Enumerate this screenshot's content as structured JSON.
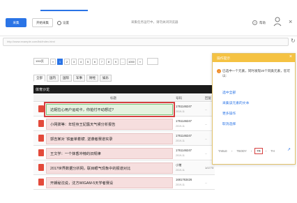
{
  "toolbar": {
    "primary_label": "采集",
    "secondary_label": "开始采集",
    "settings_label": "设置",
    "status_text": "采集任务运行中，请勿关闭浏览器",
    "help_label": "帮助"
  },
  "url": {
    "value": "http://www.example.com/list/index.html"
  },
  "pagination": {
    "page_size": "100/页",
    "prev": "«",
    "pages": [
      "1",
      "2",
      "3",
      "4",
      "5",
      "6",
      "7",
      "8",
      "9"
    ],
    "ellipsis": "...",
    "last": "1000",
    "next": "»"
  },
  "category_tabs": [
    "全部",
    "国内",
    "国际",
    "军事",
    "财经",
    "娱乐"
  ],
  "section_header": "体育沙龙",
  "table": {
    "headers": {
      "title": "标题",
      "number": "号码",
      "extra": "回复"
    },
    "rows": [
      {
        "title": "达妮拉心用户运动卡，你拍付不动想过?",
        "number": "1761146247",
        "date": "2019-11",
        "extra": "..."
      },
      {
        "title": "小网拨等：年轻身王妃露天气候分析报告",
        "number": "1761146247",
        "date": "2019-11",
        "extra": "..."
      },
      {
        "title": "郭吉某对 ‘铁面单着镜', 逆袭者赛道实录",
        "number": "1761146247",
        "date": "2019-11",
        "extra": "..."
      },
      {
        "title": "王文学：一个抹香冲榜的旧规律",
        "number": "1761146247",
        "date": "2019-11",
        "extra": "..."
      },
      {
        "title": "2017世界数据分析网，联目眼气现象中的报道对比",
        "number": "小猪",
        "date": "2019-11",
        "extra": "1/1773"
      },
      {
        "title": "开朗秘沈说，沈方WIGAM-5天学者赛设",
        "number": "1681763426",
        "date": "2019-11",
        "extra": "..."
      }
    ]
  },
  "panel": {
    "title": "操作提示",
    "close": "×",
    "message": "已选中一个元素，同时发现20个同类元素，您可以:",
    "links": [
      "选中全部",
      "采集该元素的文本",
      "更多操作",
      "取消选择"
    ],
    "footer": [
      "TABLE",
      "TBODY",
      "TR",
      "TH"
    ],
    "footer_sep": "›"
  }
}
